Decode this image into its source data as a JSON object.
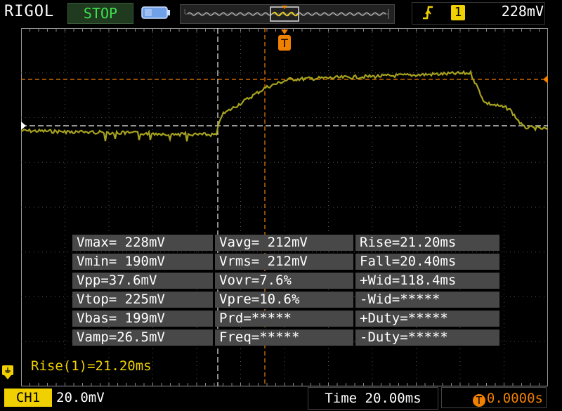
{
  "top_bar": {
    "brand": "RIGOL",
    "run_state": "STOP",
    "trigger": {
      "source": "1",
      "level": "228mV"
    }
  },
  "waveform": {
    "trigger_marker": "T"
  },
  "measurements": {
    "col1": [
      "Vmax= 228mV",
      "Vmin= 190mV",
      "Vpp=37.6mV",
      "Vtop= 225mV",
      "Vbas= 199mV",
      "Vamp=26.5mV"
    ],
    "col2": [
      "Vavg= 212mV",
      "Vrms= 212mV",
      "Vovr=7.6%",
      "Vpre=10.6%",
      "Prd=*****",
      "Freq=*****"
    ],
    "col3": [
      "Rise=21.20ms",
      "Fall=20.40ms",
      "+Wid=118.4ms",
      "-Wid=*****",
      "+Duty=*****",
      "-Duty=*****"
    ]
  },
  "rise_readout": "Rise(1)=21.20ms",
  "bottom_bar": {
    "channel": "CH1",
    "scale": "20.0mV",
    "time": "Time 20.00ms",
    "trigger_position": "0.0000s",
    "trigger_position_icon": "T"
  },
  "colors": {
    "trace": "#a6a21e",
    "trigger": "#f08000",
    "channel": "#f0d000",
    "run_state": "#3ee04a"
  }
}
